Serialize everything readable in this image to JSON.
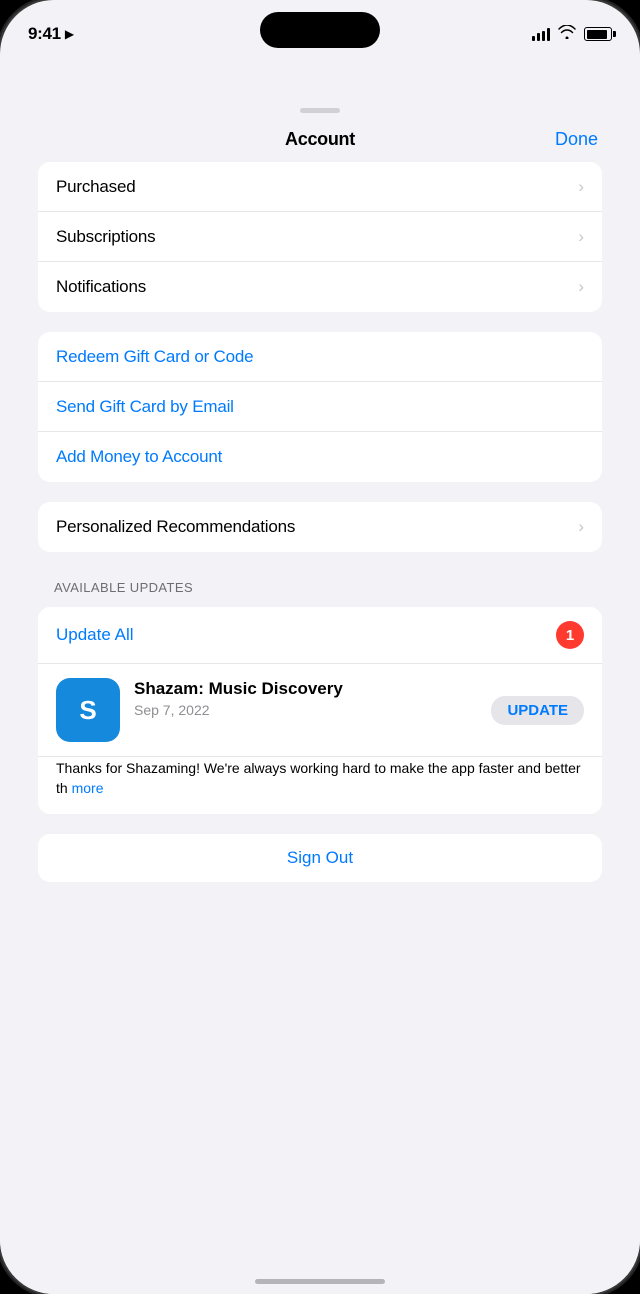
{
  "status_bar": {
    "time": "9:41",
    "signal_strength": 4,
    "wifi": true,
    "battery": 90
  },
  "modal": {
    "title": "Account",
    "done_button_label": "Done"
  },
  "section1": {
    "items": [
      {
        "label": "Purchased",
        "has_chevron": true
      },
      {
        "label": "Subscriptions",
        "has_chevron": true
      },
      {
        "label": "Notifications",
        "has_chevron": true
      }
    ]
  },
  "section2": {
    "items": [
      {
        "label": "Redeem Gift Card or Code",
        "is_blue": true,
        "has_chevron": false
      },
      {
        "label": "Send Gift Card by Email",
        "is_blue": true,
        "has_chevron": false
      },
      {
        "label": "Add Money to Account",
        "is_blue": true,
        "has_chevron": false
      }
    ]
  },
  "section3": {
    "items": [
      {
        "label": "Personalized Recommendations",
        "has_chevron": true
      }
    ]
  },
  "available_updates": {
    "section_label": "AVAILABLE UPDATES",
    "update_all_label": "Update All",
    "badge_count": "1",
    "apps": [
      {
        "name": "Shazam: Music Discovery",
        "date": "Sep 7, 2022",
        "description": "Thanks for Shazaming! We're always working hard to make the app faster and better th",
        "more_label": "more",
        "update_button_label": "UPDATE"
      }
    ]
  },
  "sign_out": {
    "label": "Sign Out"
  }
}
